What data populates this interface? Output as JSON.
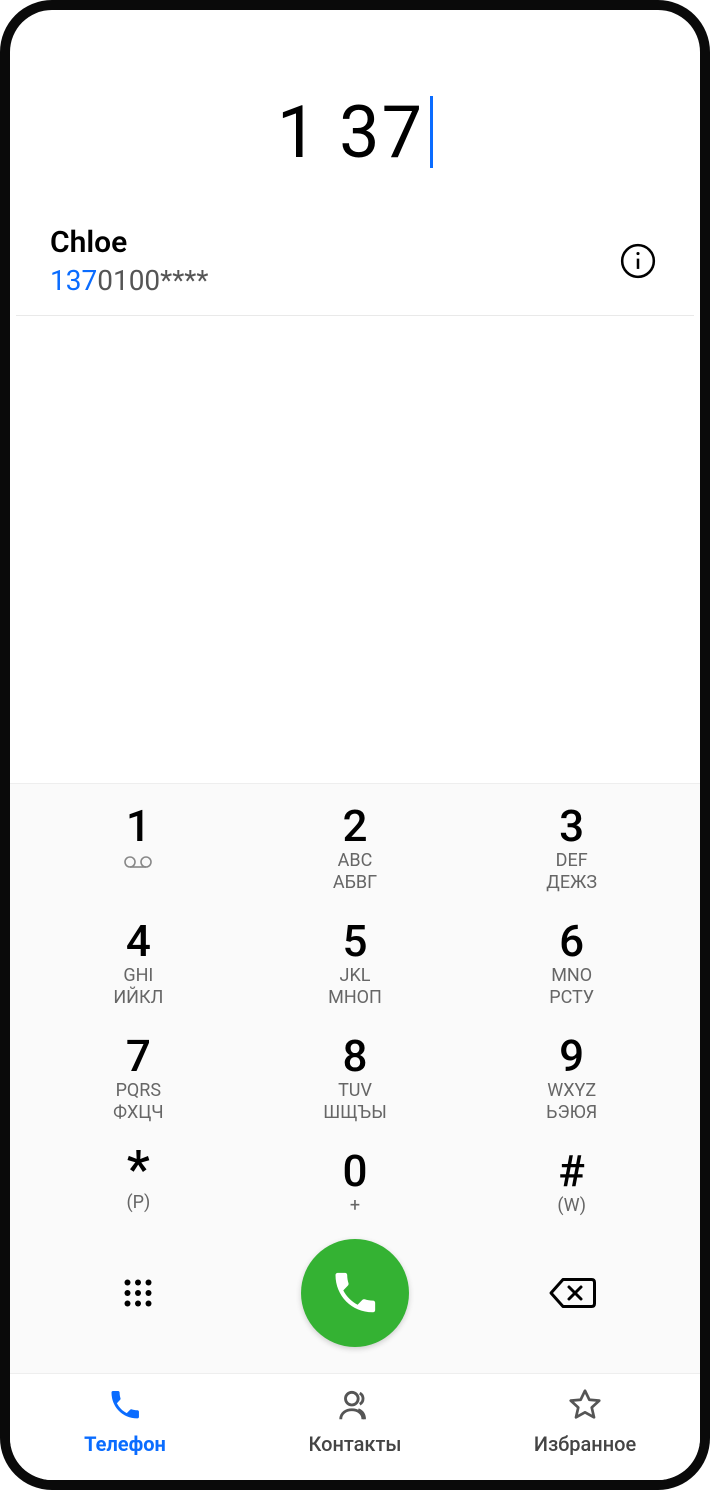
{
  "display": {
    "typed": "1 37"
  },
  "suggestion": {
    "name": "Chloe",
    "number_highlight": "137",
    "number_rest": "0100****"
  },
  "keypad": [
    {
      "digit": "1",
      "sub": "",
      "sub2": "",
      "vm": true
    },
    {
      "digit": "2",
      "sub": "ABC",
      "sub2": "АБВГ"
    },
    {
      "digit": "3",
      "sub": "DEF",
      "sub2": "ДЕЖЗ"
    },
    {
      "digit": "4",
      "sub": "GHI",
      "sub2": "ИЙКЛ"
    },
    {
      "digit": "5",
      "sub": "JKL",
      "sub2": "МНОП"
    },
    {
      "digit": "6",
      "sub": "MNO",
      "sub2": "РСТУ"
    },
    {
      "digit": "7",
      "sub": "PQRS",
      "sub2": "ФХЦЧ"
    },
    {
      "digit": "8",
      "sub": "TUV",
      "sub2": "ШЩЪЫ"
    },
    {
      "digit": "9",
      "sub": "WXYZ",
      "sub2": "ЬЭЮЯ"
    },
    {
      "digit": "*",
      "sub": "(P)",
      "sub2": ""
    },
    {
      "digit": "0",
      "sub": "+",
      "sub2": ""
    },
    {
      "digit": "#",
      "sub": "(W)",
      "sub2": ""
    }
  ],
  "tabs": {
    "phone": "Телефон",
    "contacts": "Контакты",
    "favorites": "Избранное"
  },
  "colors": {
    "accent": "#0a6cff",
    "call": "#34b233"
  }
}
